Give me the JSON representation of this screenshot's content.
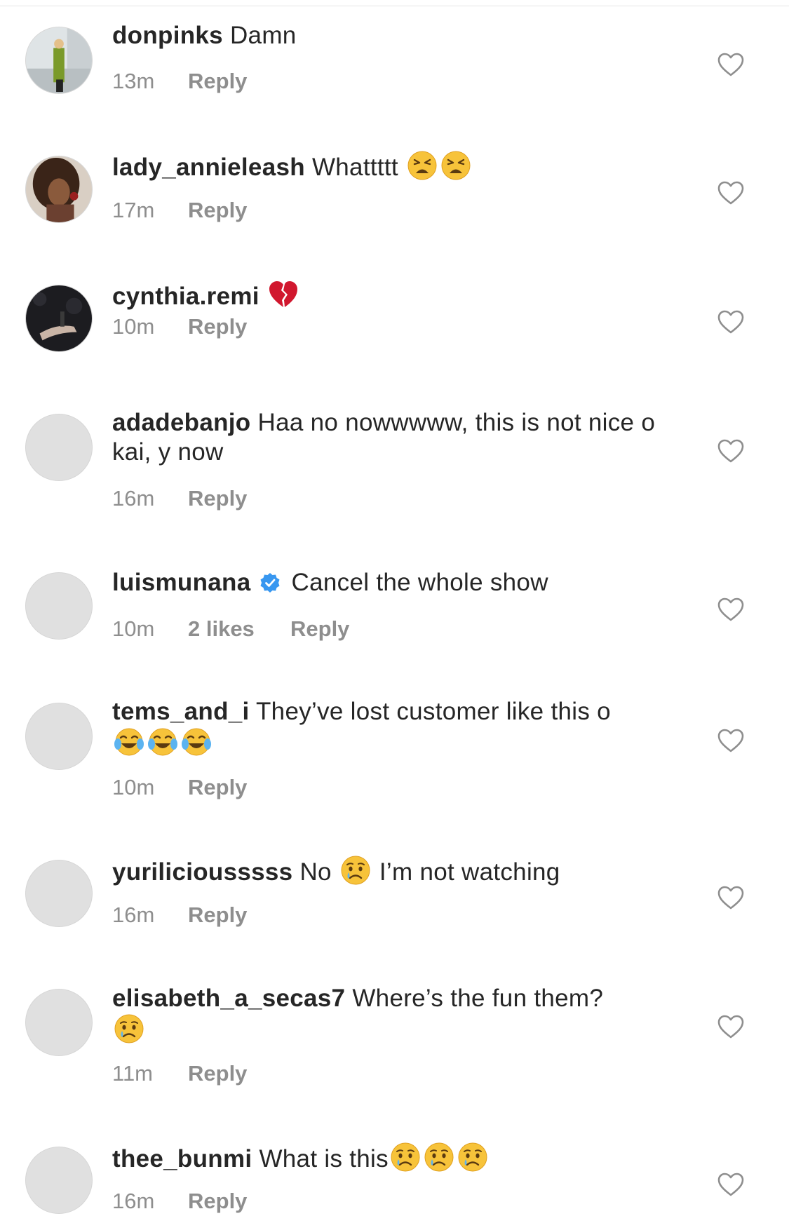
{
  "reply_label": "Reply",
  "comments": [
    {
      "username": "donpinks",
      "text_before": "Damn",
      "text_after": "",
      "time": "13m",
      "likes": "",
      "avatar": "photo-green-coat"
    },
    {
      "username": "lady_annieleash",
      "text_before": "Whattttt",
      "text_after": "",
      "emojis": [
        "tired-face-emoji",
        "tired-face-emoji"
      ],
      "time": "17m",
      "likes": "",
      "avatar": "photo-curly-hair"
    },
    {
      "username": "cynthia.remi",
      "text_before": "",
      "text_after": "",
      "emojis": [
        "broken-heart-emoji"
      ],
      "time": "10m",
      "likes": "",
      "avatar": "photo-dark-hands"
    },
    {
      "username": "adadebanjo",
      "text_before": "Haa no nowwwww, this is not nice o kai, y now",
      "text_after": "",
      "time": "16m",
      "likes": "",
      "avatar": "placeholder"
    },
    {
      "username": "luismunana",
      "verified": true,
      "text_before": "Cancel the whole show",
      "text_after": "",
      "time": "10m",
      "likes": "2 likes",
      "avatar": "placeholder"
    },
    {
      "username": "tems_and_i",
      "text_before": "They’ve lost customer like this o",
      "text_after": "",
      "emojis": [
        "tears-of-joy-emoji",
        "tears-of-joy-emoji",
        "tears-of-joy-emoji"
      ],
      "time": "10m",
      "likes": "",
      "avatar": "placeholder"
    },
    {
      "username": "yuriliciousssss",
      "text_before": "No",
      "text_after": "I’m not watching",
      "emojis": [
        "crying-face-emoji"
      ],
      "time": "16m",
      "likes": "",
      "avatar": "placeholder"
    },
    {
      "username": "elisabeth_a_secas7",
      "text_before": "Where’s the fun them?",
      "text_after": "",
      "emojis": [
        "crying-face-emoji"
      ],
      "time": "11m",
      "likes": "",
      "avatar": "placeholder"
    },
    {
      "username": "thee_bunmi",
      "text_before": "What is this",
      "text_after": "",
      "emojis": [
        "crying-face-emoji",
        "crying-face-emoji",
        "crying-face-emoji"
      ],
      "time": "16m",
      "likes": "",
      "avatar": "placeholder"
    }
  ]
}
